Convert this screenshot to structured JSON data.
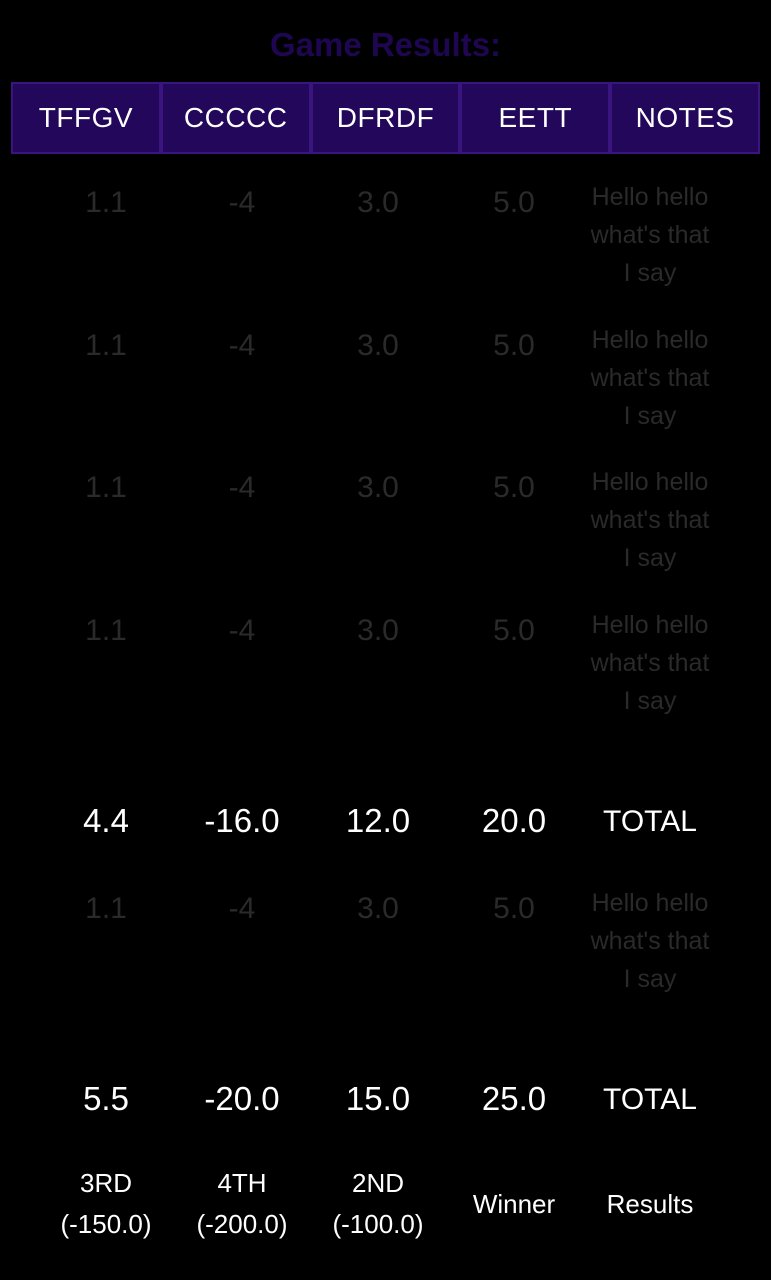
{
  "title": "Game Results:",
  "header": [
    "TFFGV",
    "CCCCC",
    "DFRDF",
    "EETT",
    "NOTES"
  ],
  "rows_group1": [
    {
      "values": [
        "1.1",
        "-4",
        "3.0",
        "5.0"
      ],
      "note": [
        "Hello hello",
        "what's that",
        "I say"
      ]
    },
    {
      "values": [
        "1.1",
        "-4",
        "3.0",
        "5.0"
      ],
      "note": [
        "Hello hello",
        "what's that",
        "I say"
      ]
    },
    {
      "values": [
        "1.1",
        "-4",
        "3.0",
        "5.0"
      ],
      "note": [
        "Hello hello",
        "what's that",
        "I say"
      ]
    },
    {
      "values": [
        "1.1",
        "-4",
        "3.0",
        "5.0"
      ],
      "note": [
        "Hello hello",
        "what's that",
        "I say"
      ]
    }
  ],
  "total1": {
    "values": [
      "4.4",
      "-16.0",
      "12.0",
      "20.0"
    ],
    "label": "TOTAL"
  },
  "rows_group2": [
    {
      "values": [
        "1.1",
        "-4",
        "3.0",
        "5.0"
      ],
      "note": [
        "Hello hello",
        "what's that",
        "I say"
      ]
    }
  ],
  "total2": {
    "values": [
      "5.5",
      "-20.0",
      "15.0",
      "25.0"
    ],
    "label": "TOTAL"
  },
  "results": {
    "placements": [
      {
        "place": "3RD",
        "score": "(-150.0)"
      },
      {
        "place": "4TH",
        "score": "(-200.0)"
      },
      {
        "place": "2ND",
        "score": "(-100.0)"
      }
    ],
    "winner": "Winner",
    "label": "Results"
  },
  "colors": {
    "accent": "#22075a",
    "title": "#1e0750",
    "dim_text": "#2a2a2a"
  }
}
